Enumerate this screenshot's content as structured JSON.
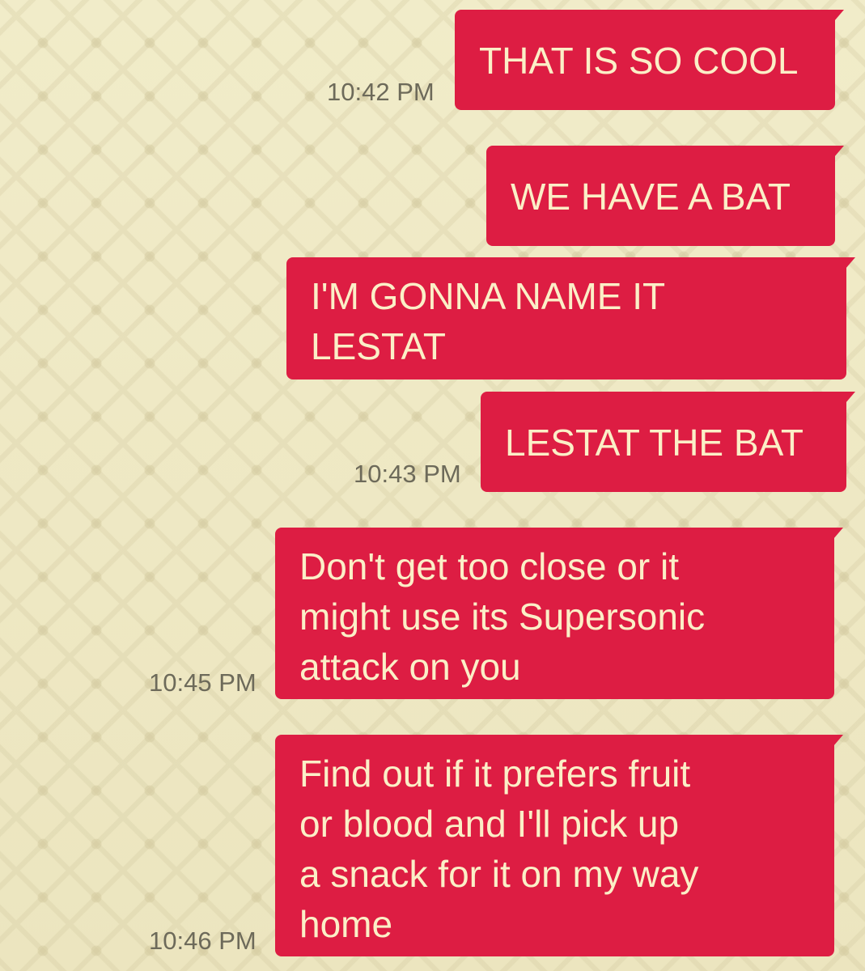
{
  "messages": [
    {
      "text": "THAT IS SO COOL",
      "time": "10:42 PM"
    },
    {
      "text": "WE HAVE A BAT",
      "time": ""
    },
    {
      "text": "I'M GONNA NAME IT\nLESTAT",
      "time": ""
    },
    {
      "text": "LESTAT THE BAT",
      "time": "10:43 PM"
    },
    {
      "text": "Don't get too close or it\nmight use its Supersonic\nattack on you",
      "time": "10:45 PM"
    },
    {
      "text": "Find out if it prefers fruit\nor blood and I'll pick up\na snack for it on my way\nhome",
      "time": "10:46 PM"
    }
  ],
  "colors": {
    "bubble": "#dd1d43",
    "bubble_text": "#fbefc7",
    "timestamp": "#6d6a5a",
    "background": "#efe9c4"
  }
}
